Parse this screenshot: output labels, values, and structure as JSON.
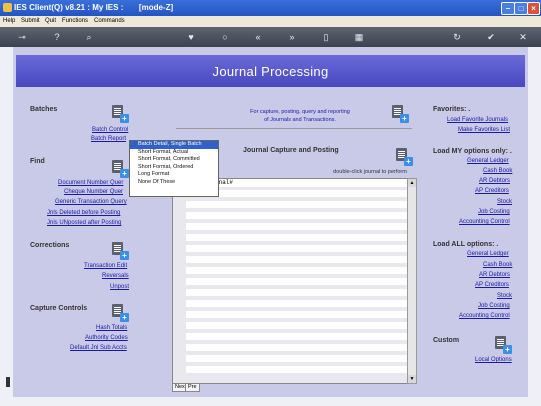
{
  "window": {
    "title": "IES Client(Q) v8.21 : My IES :       [mode-Z]"
  },
  "menu": [
    "Help",
    "Submit",
    "Quit",
    "Functions",
    "Commands"
  ],
  "toolbar": {
    "icons": [
      "key-icon",
      "help-icon",
      "search-icon",
      "heart-icon",
      "circle-icon",
      "rewind-icon",
      "fastforward-icon",
      "document-icon",
      "grid-icon",
      "refresh-icon",
      "check-icon",
      "close-icon"
    ],
    "glyphs": [
      "⊸",
      "?",
      "⌕",
      "♥",
      "○",
      "«",
      "»",
      "▯",
      "▦",
      "↻",
      "✔",
      "✕"
    ]
  },
  "page": {
    "title": "Journal Processing"
  },
  "info": {
    "line1": "For capture, posting, query and reporting",
    "line2": "of Journals and Transactions."
  },
  "batches": {
    "title": "Batches",
    "control": "Batch Control",
    "report": "Batch Report"
  },
  "find": {
    "title": "Find",
    "items": [
      "Document Number Quer",
      "Cheque Number Quer",
      "Generic Transaction Query",
      "Jnls Deleted before Posting",
      "Jnls UNposted after Posting"
    ]
  },
  "corrections": {
    "title": "Corrections",
    "items": [
      "Transaction Edit",
      "Reversals",
      "Unpost"
    ]
  },
  "capture": {
    "title": "Capture Controls",
    "items": [
      "Hash Totals",
      "Authority Codes",
      "Default Jnl Sub Accts"
    ]
  },
  "center": {
    "title": "Journal Capture and Posting",
    "hint": "double-click journal to perform",
    "col": "rnal#"
  },
  "dropdown": {
    "items": [
      "Batch Detail, Single Batch",
      "Short Format, Actual",
      "Short Format, Committed",
      "Short Format, Ordered",
      "Long Format",
      "None Of These"
    ]
  },
  "favorites": {
    "title": "Favorites: .",
    "items": [
      "Load Favorite Journals",
      "Make Favorites List"
    ]
  },
  "my": {
    "title": "Load MY options only: .",
    "items": [
      "General Ledger",
      "Cash Book",
      "AR Debtors",
      "AP Creditors",
      "Stock",
      "Job Costing",
      "Accounting Control"
    ]
  },
  "all": {
    "title": "Load ALL options: .",
    "items": [
      "General Ledger",
      "Cash Book",
      "AR Debtors",
      "AP Creditors",
      "Stock",
      "Job Costing",
      "Accounting Control"
    ]
  },
  "custom": {
    "title": "Custom",
    "items": [
      "Local Options"
    ]
  },
  "pager": {
    "next": "Nex",
    "prev": "Pre"
  }
}
